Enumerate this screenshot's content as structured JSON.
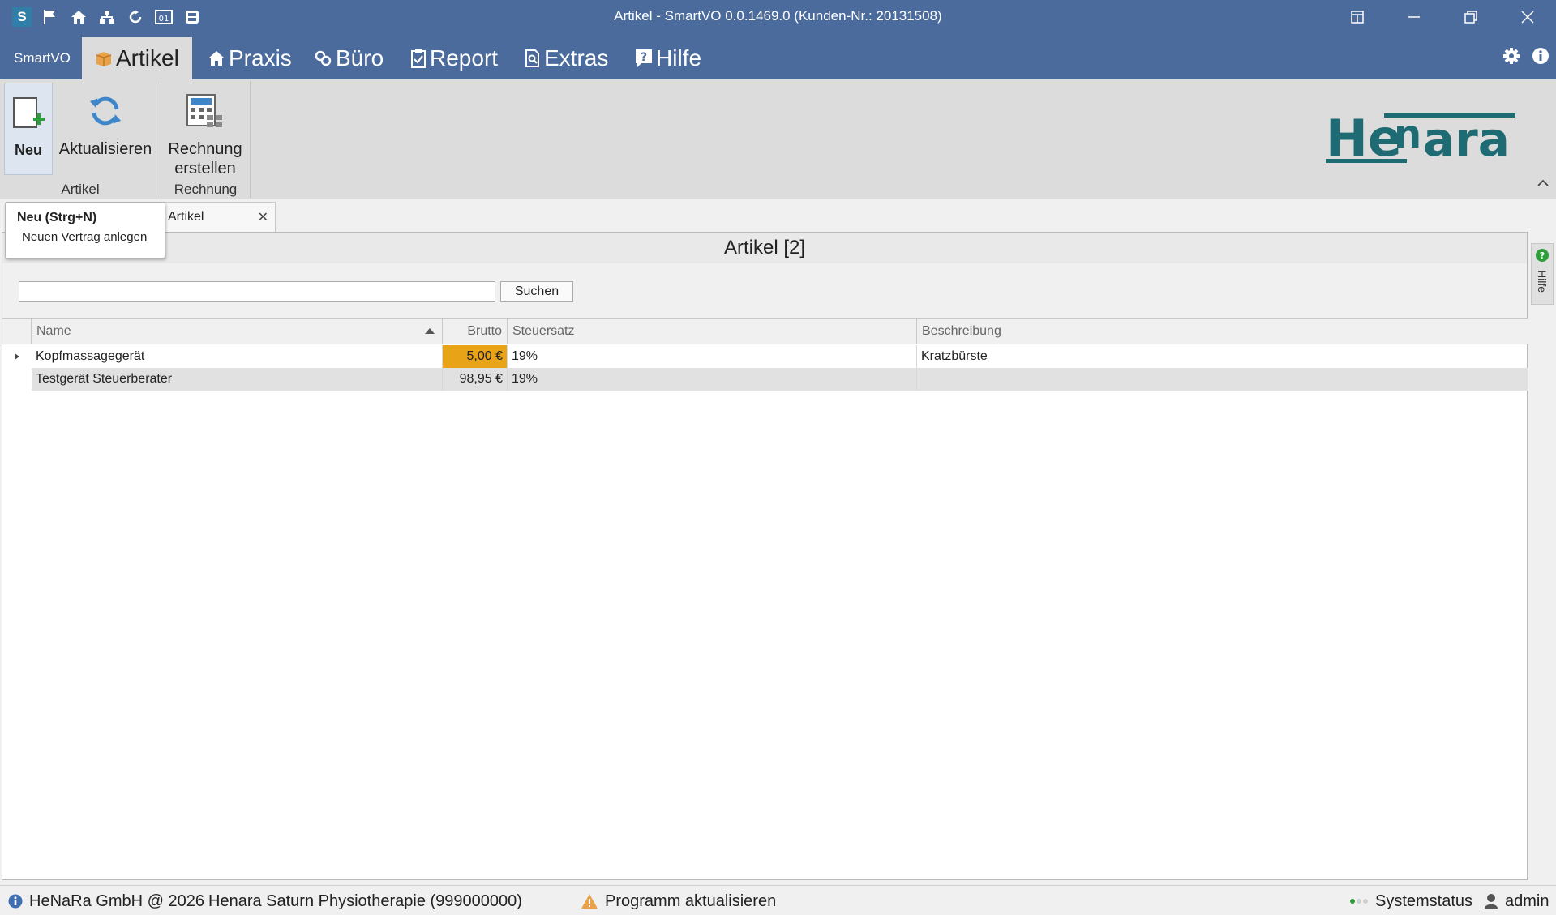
{
  "window": {
    "title": "Artikel - SmartVO 0.0.1469.0 (Kunden-Nr.: 20131508)",
    "app_icon_letter": "S"
  },
  "menu": {
    "app": "SmartVO",
    "tabs": [
      {
        "label": "Artikel",
        "icon": "box-icon",
        "active": true
      },
      {
        "label": "Praxis",
        "icon": "home-icon"
      },
      {
        "label": "Büro",
        "icon": "link-icon"
      },
      {
        "label": "Report",
        "icon": "clipboard-icon"
      },
      {
        "label": "Extras",
        "icon": "document-search-icon"
      },
      {
        "label": "Hilfe",
        "icon": "help-icon"
      }
    ]
  },
  "ribbon": {
    "neu_label": "Neu",
    "aktualisieren_label": "Aktualisieren",
    "rechnung_label_1": "Rechnung",
    "rechnung_label_2": "erstellen",
    "group_artikel": "Artikel",
    "group_rechnung": "Rechnung",
    "logo_text_he": "He",
    "logo_text_n": "n",
    "logo_text_ara": "ara"
  },
  "tooltip": {
    "title": "Neu (Strg+N)",
    "description": "Neuen Vertrag anlegen"
  },
  "doc_tab": {
    "label": "Artikel"
  },
  "content": {
    "header": "Artikel [2]",
    "search_value": "",
    "search_button": "Suchen"
  },
  "grid": {
    "columns": [
      "Name",
      "Brutto",
      "Steuersatz",
      "Beschreibung"
    ],
    "sorted_column": "Name",
    "rows": [
      {
        "name": "Kopfmassagegerät",
        "brutto": "5,00 €",
        "steuersatz": "19%",
        "beschreibung": "Kratzbürste"
      },
      {
        "name": "Testgerät Steuerberater",
        "brutto": "98,95 €",
        "steuersatz": "19%",
        "beschreibung": ""
      }
    ]
  },
  "help_side": {
    "label": "Hilfe"
  },
  "status": {
    "copyright": "HeNaRa GmbH @ 2026",
    "practice": "Henara Saturn Physiotherapie (999000000)",
    "update": "Programm aktualisieren",
    "systemstatus": "Systemstatus",
    "user": "admin"
  },
  "colors": {
    "titlebar": "#4a6b9c",
    "ribbon": "#dcdcdc",
    "highlight_cell": "#e8a317",
    "logo": "#1f6b73"
  }
}
